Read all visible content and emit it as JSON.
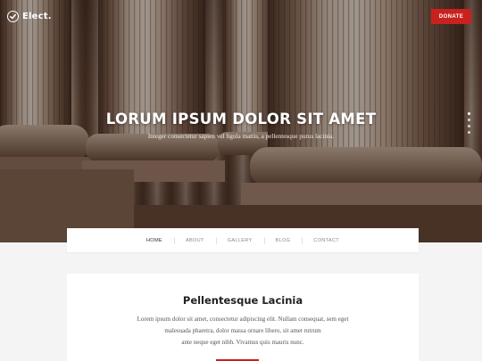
{
  "header": {
    "brand": "Elect.",
    "donate_label": "DONATE"
  },
  "hero": {
    "title": "LORUM IPSUM DOLOR SIT AMET",
    "subtitle": "Integer consectetur sapien vel ligula mattis, a pellentesque purus lacinia.",
    "slide_count": 4,
    "active_slide": 1
  },
  "nav": {
    "items": [
      {
        "label": "HOME"
      },
      {
        "label": "ABOUT"
      },
      {
        "label": "GALLERY"
      },
      {
        "label": "BLOG"
      },
      {
        "label": "CONTACT"
      }
    ]
  },
  "section": {
    "title": "Pellentesque Lacinia",
    "lines": [
      "Lorem ipsum dolor sit amet, consectetur adipiscing elit. Nullam consequat, sem eget",
      "malesuada pharetra, dolor massa ornare libero, sit amet rutrum",
      "ante neque eget nibh. Vivamus quis mauris nunc."
    ]
  },
  "colors": {
    "accent": "#c9211e",
    "hero_overlay": "#3b2a22"
  },
  "icons": {
    "brand": "check-circle-icon"
  }
}
